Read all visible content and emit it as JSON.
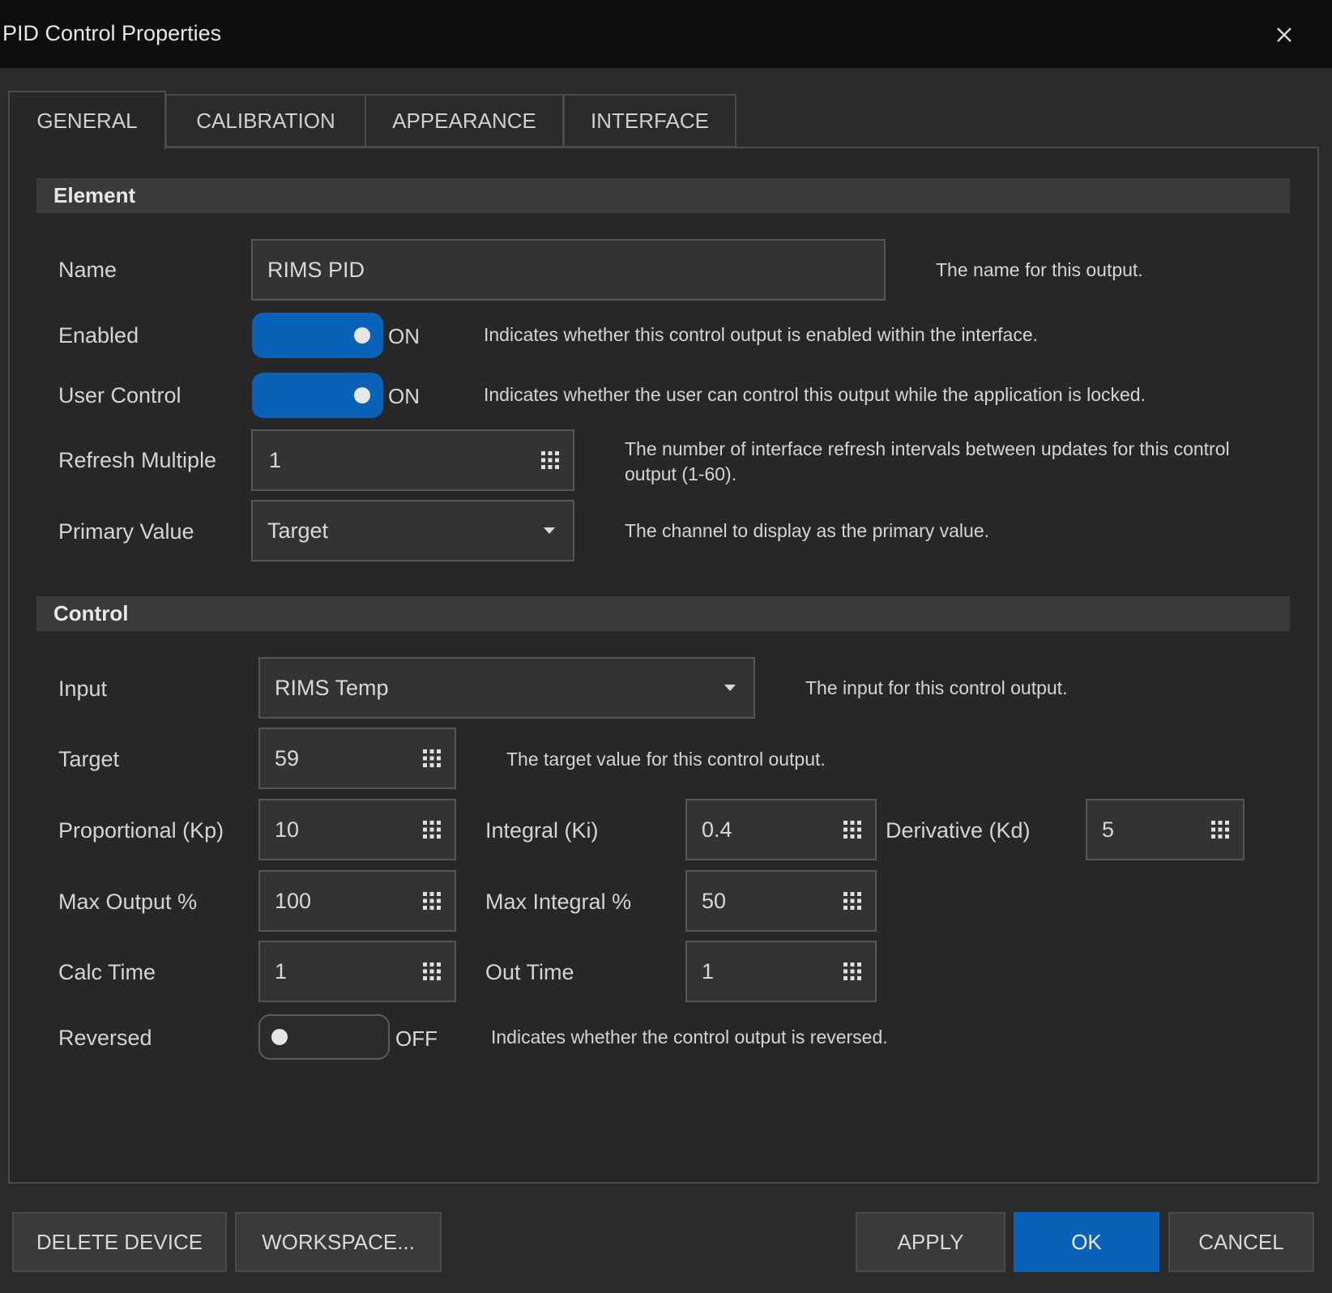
{
  "window": {
    "title": "PID Control Properties"
  },
  "tabs": [
    {
      "label": "GENERAL",
      "active": true
    },
    {
      "label": "CALIBRATION"
    },
    {
      "label": "APPEARANCE"
    },
    {
      "label": "INTERFACE"
    }
  ],
  "element_section": {
    "heading": "Element",
    "name": {
      "label": "Name",
      "value": "RIMS PID",
      "desc": "The name for this output."
    },
    "enabled": {
      "label": "Enabled",
      "state": "ON",
      "desc": "Indicates whether this control output is enabled within the interface."
    },
    "user_control": {
      "label": "User Control",
      "state": "ON",
      "desc": "Indicates whether the user can control this output while the application is locked."
    },
    "refresh_multiple": {
      "label": "Refresh Multiple",
      "value": "1",
      "desc": "The number of interface refresh intervals between updates for this control output (1-60)."
    },
    "primary_value": {
      "label": "Primary Value",
      "value": "Target",
      "desc": "The channel to display as the primary value."
    }
  },
  "control_section": {
    "heading": "Control",
    "input": {
      "label": "Input",
      "value": "RIMS Temp",
      "desc": "The input for this control output."
    },
    "target": {
      "label": "Target",
      "value": "59",
      "desc": "The target value for this control output."
    },
    "kp": {
      "label": "Proportional (Kp)",
      "value": "10"
    },
    "ki": {
      "label": "Integral (Ki)",
      "value": "0.4"
    },
    "kd": {
      "label": "Derivative (Kd)",
      "value": "5"
    },
    "max_output": {
      "label": "Max Output %",
      "value": "100"
    },
    "max_integral": {
      "label": "Max Integral %",
      "value": "50"
    },
    "calc_time": {
      "label": "Calc Time",
      "value": "1"
    },
    "out_time": {
      "label": "Out Time",
      "value": "1"
    },
    "reversed": {
      "label": "Reversed",
      "state": "OFF",
      "desc": "Indicates whether the control output is reversed."
    }
  },
  "footer": {
    "delete_label": "DELETE DEVICE",
    "workspace_label": "WORKSPACE...",
    "apply_label": "APPLY",
    "ok_label": "OK",
    "cancel_label": "CANCEL"
  },
  "colors": {
    "accent": "#0a62b8",
    "titlebar": "#0e0e0e",
    "background": "#2a2a2a",
    "section": "#3a3a3a"
  },
  "icons": {
    "close": "close-icon",
    "numeric_keypad": "keypad-icon",
    "dropdown": "chevron-down-icon"
  }
}
